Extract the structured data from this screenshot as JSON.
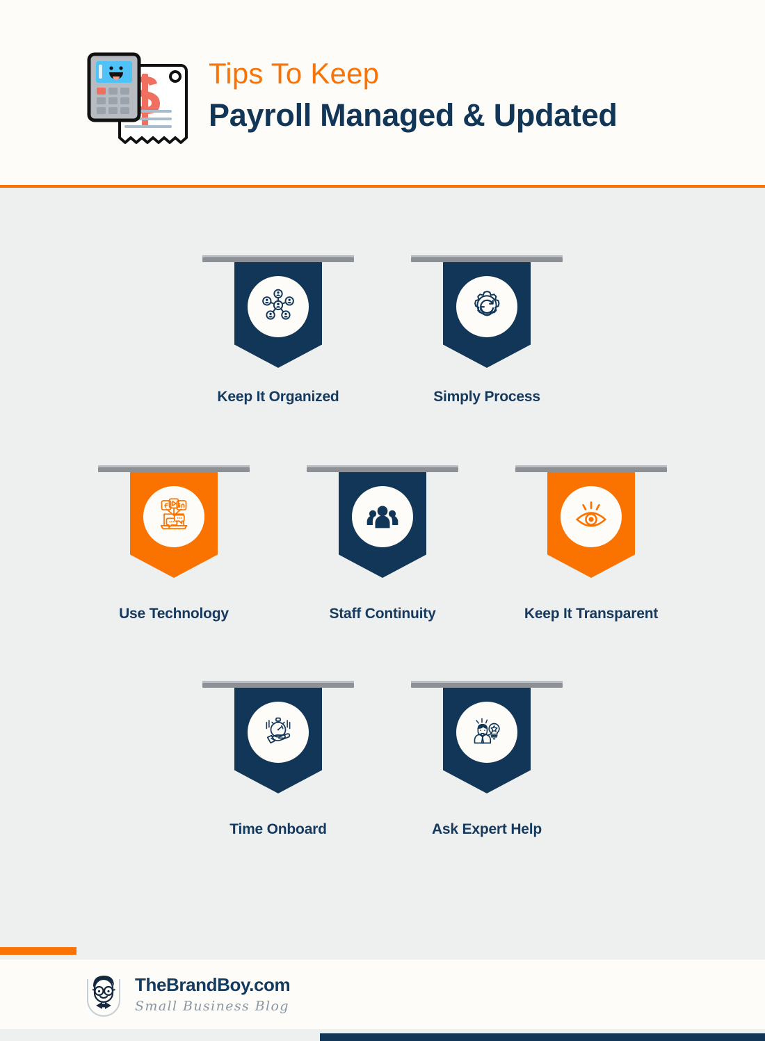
{
  "colors": {
    "navy": "#123658",
    "orange": "#fa7300",
    "header_orange": "#f97306",
    "page_bg": "#eeefef",
    "panel_bg": "#fdfcf8",
    "rod_gray": "#8d9196",
    "label_navy": "#153a5e"
  },
  "header": {
    "icon_name": "calculator-receipt-icon",
    "title_top": "Tips To Keep",
    "title_main": "Payroll Managed & Updated"
  },
  "tips": [
    {
      "label": "Keep It Organized",
      "icon": "network-people-icon",
      "color": "navy",
      "row": 1
    },
    {
      "label": "Simply Process",
      "icon": "gear-refresh-icon",
      "color": "navy",
      "row": 1
    },
    {
      "label": "Use Technology",
      "icon": "laptop-social-media-icon",
      "color": "orange",
      "row": 2
    },
    {
      "label": "Staff Continuity",
      "icon": "people-group-icon",
      "color": "navy",
      "row": 2
    },
    {
      "label": "Keep It Transparent",
      "icon": "eye-icon",
      "color": "orange",
      "row": 2
    },
    {
      "label": "Time Onboard",
      "icon": "hand-stopwatch-icon",
      "color": "navy",
      "row": 3
    },
    {
      "label": "Ask Expert Help",
      "icon": "expert-lightbulb-icon",
      "color": "navy",
      "row": 3
    }
  ],
  "footer": {
    "logo_icon": "brandboy-avatar-icon",
    "brand_name": "TheBrandBoy.com",
    "brand_tagline": "Small Business Blog"
  }
}
